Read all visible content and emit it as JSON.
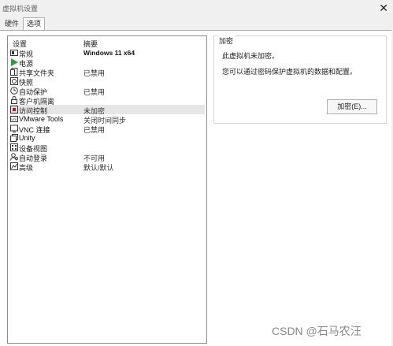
{
  "window": {
    "title": "虚拟机设置",
    "close_glyph": "✕"
  },
  "tabs": [
    {
      "label": "硬件"
    },
    {
      "label": "选项"
    }
  ],
  "list": {
    "headers": {
      "setting": "设置",
      "summary": "摘要"
    },
    "rows": [
      {
        "label": "常规",
        "summary": "Windows 11 x64",
        "icon": "general-icon"
      },
      {
        "label": "电源",
        "summary": "",
        "icon": "power-play-icon"
      },
      {
        "label": "共享文件夹",
        "summary": "已禁用",
        "icon": "shared-folder-icon"
      },
      {
        "label": "快照",
        "summary": "",
        "icon": "snapshot-icon"
      },
      {
        "label": "自动保护",
        "summary": "已禁用",
        "icon": "autoprotect-clock-icon"
      },
      {
        "label": "客户机隔离",
        "summary": "",
        "icon": "isolation-lock-icon"
      },
      {
        "label": "访问控制",
        "summary": "未加密",
        "icon": "access-control-icon"
      },
      {
        "label": "VMware Tools",
        "summary": "关闭时间同步",
        "icon": "vmware-tools-icon"
      },
      {
        "label": "VNC 连接",
        "summary": "已禁用",
        "icon": "vnc-icon"
      },
      {
        "label": "Unity",
        "summary": "",
        "icon": "unity-icon"
      },
      {
        "label": "设备视图",
        "summary": "",
        "icon": "device-view-icon"
      },
      {
        "label": "自动登录",
        "summary": "不可用",
        "icon": "autologin-icon"
      },
      {
        "label": "高级",
        "summary": "默认/默认",
        "icon": "advanced-icon"
      }
    ]
  },
  "encryption": {
    "group_title": "加密",
    "line1": "此虚拟机未加密。",
    "line2": "您可以通过密码保护虚拟机的数据和配置。",
    "button_label": "加密(E)..."
  },
  "watermark": "CSDN @石马农汪"
}
